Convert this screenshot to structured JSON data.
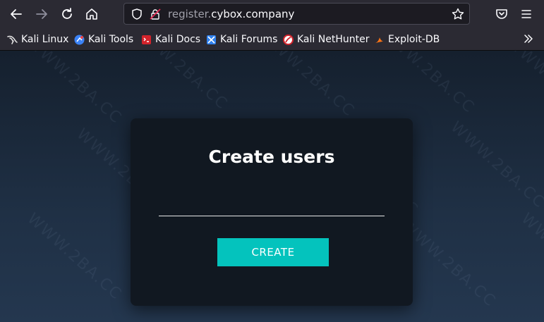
{
  "browser": {
    "url_subdomain": "register.",
    "url_domain": "cybox.company"
  },
  "bookmarks": [
    {
      "label": "Kali Linux",
      "icon": "kali-dragon-icon"
    },
    {
      "label": "Kali Tools",
      "icon": "kali-tools-icon"
    },
    {
      "label": "Kali Docs",
      "icon": "kali-docs-icon"
    },
    {
      "label": "Kali Forums",
      "icon": "kali-forums-icon"
    },
    {
      "label": "Kali NetHunter",
      "icon": "kali-nethunter-icon"
    },
    {
      "label": "Exploit-DB",
      "icon": "exploit-db-icon"
    }
  ],
  "form": {
    "title": "Create users",
    "input_value": "",
    "button_label": "CREATE"
  },
  "watermark": "WWW.2BA.CC",
  "colors": {
    "accent": "#04c3bd",
    "card_bg": "#111821",
    "toolbar_bg": "#2b2a33"
  }
}
